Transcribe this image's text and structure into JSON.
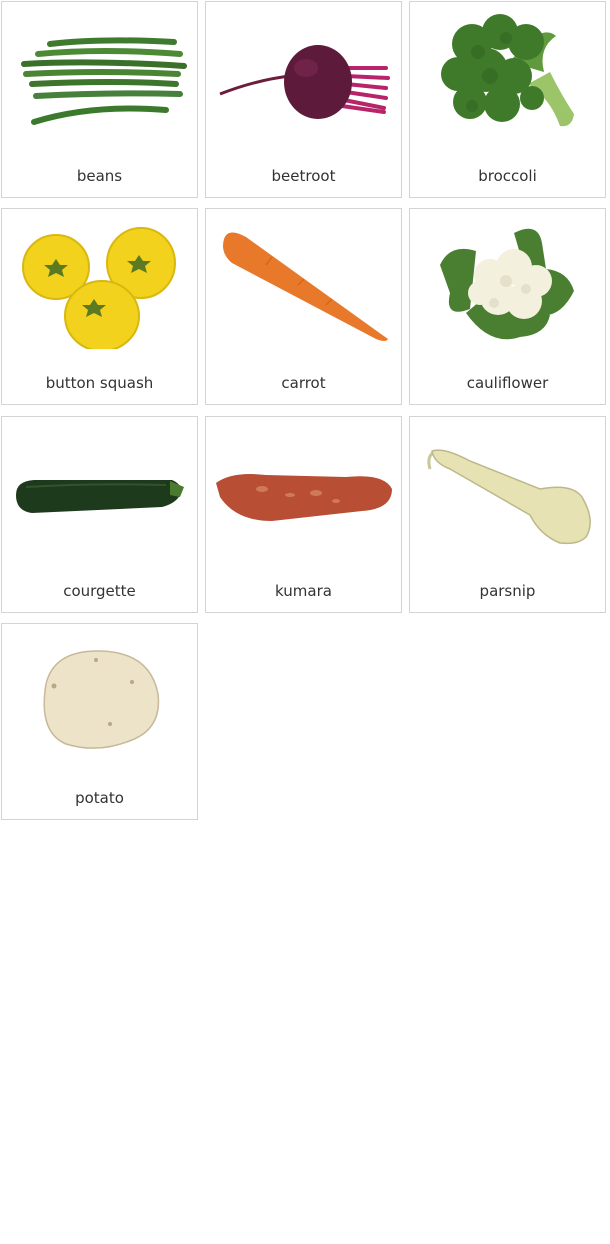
{
  "cards": [
    {
      "label": "beans",
      "icon": "beans-image"
    },
    {
      "label": "beetroot",
      "icon": "beetroot-image"
    },
    {
      "label": "broccoli",
      "icon": "broccoli-image"
    },
    {
      "label": "button squash",
      "icon": "button-squash-image"
    },
    {
      "label": "carrot",
      "icon": "carrot-image"
    },
    {
      "label": "cauliflower",
      "icon": "cauliflower-image"
    },
    {
      "label": "courgette",
      "icon": "courgette-image"
    },
    {
      "label": "kumara",
      "icon": "kumara-image"
    },
    {
      "label": "parsnip",
      "icon": "parsnip-image"
    },
    {
      "label": "potato",
      "icon": "potato-image"
    }
  ]
}
